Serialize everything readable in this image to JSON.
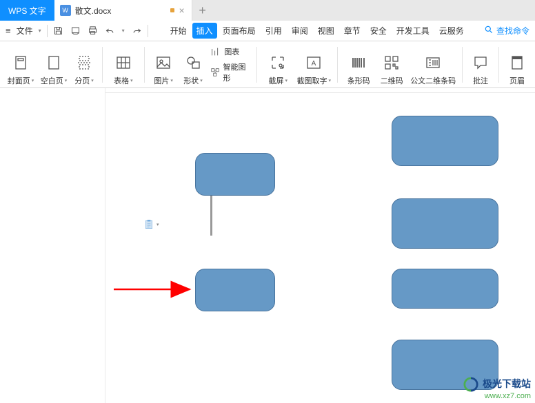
{
  "app": {
    "name": "WPS 文字"
  },
  "tab": {
    "filename": "散文.docx"
  },
  "menubar": {
    "file": "文件",
    "tabs": [
      "开始",
      "插入",
      "页面布局",
      "引用",
      "审阅",
      "视图",
      "章节",
      "安全",
      "开发工具",
      "云服务"
    ],
    "search": "查找命令"
  },
  "ribbon": {
    "cover": "封面页",
    "blank": "空白页",
    "pagebreak": "分页",
    "table": "表格",
    "picture": "图片",
    "shapes": "形状",
    "chart": "图表",
    "smartart": "智能图形",
    "screenshot": "截屏",
    "ocr": "截图取字",
    "barcode": "条形码",
    "qrcode": "二维码",
    "doc2d": "公文二维条码",
    "comment": "批注",
    "header": "页眉"
  },
  "watermark": {
    "line1": "极光下载站",
    "line2": "www.xz7.com"
  }
}
